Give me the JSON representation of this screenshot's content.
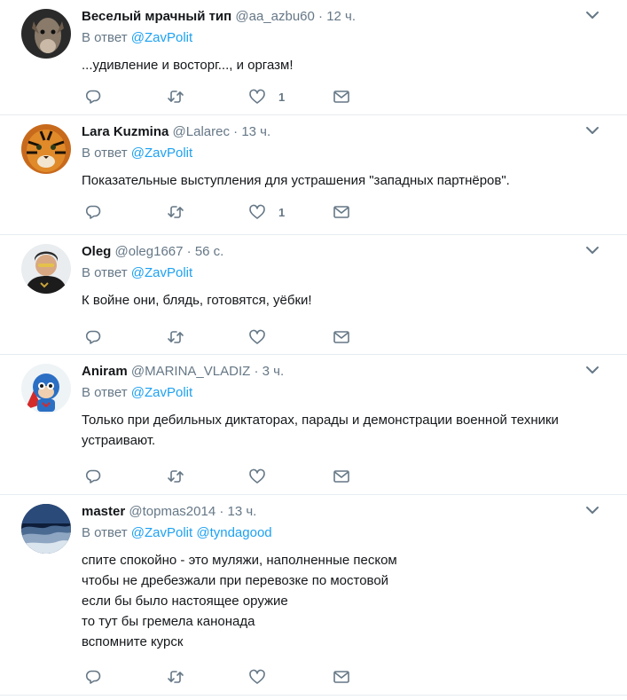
{
  "icons": {
    "reply": "reply-icon",
    "retweet": "retweet-icon",
    "like": "heart-icon",
    "dm": "envelope-icon",
    "caret": "chevron-down-icon"
  },
  "colors": {
    "link": "#1da1f2",
    "secondary": "#657786",
    "text": "#14171a",
    "divider": "#e6ecf0"
  },
  "reply_prefix": "В ответ",
  "tweets": [
    {
      "name": "Веселый мрачный тип",
      "handle": "@aa_azbu60",
      "time": "12 ч.",
      "mentions": [
        "@ZavPolit"
      ],
      "lines": [
        "...удивление и восторг..., и оргазм!"
      ],
      "likes": "1"
    },
    {
      "name": "Lara Kuzmina",
      "handle": "@Lalarec",
      "time": "13 ч.",
      "mentions": [
        "@ZavPolit"
      ],
      "lines": [
        "Показательные выступления для устрашения \"западных партнёров\"."
      ],
      "likes": "1"
    },
    {
      "name": "Oleg",
      "handle": "@oleg1667",
      "time": "56 с.",
      "mentions": [
        "@ZavPolit"
      ],
      "lines": [
        "К войне они, блядь, готовятся, уёбки!"
      ],
      "likes": ""
    },
    {
      "name": "Aniram",
      "handle": "@MARINA_VLADIZ",
      "time": "3 ч.",
      "mentions": [
        "@ZavPolit"
      ],
      "lines": [
        "Только при дебильных диктаторах, парады и демонстрации военной техники",
        "устраивают."
      ],
      "likes": ""
    },
    {
      "name": "master",
      "handle": "@topmas2014",
      "time": "13 ч.",
      "mentions": [
        "@ZavPolit",
        "@tyndagood"
      ],
      "lines": [
        "спите спокойно - это муляжи, наполненные песком",
        "чтобы не дребезжали при перевозке по мостовой",
        "если бы было настоящее оружие",
        "то тут бы гремела канонада",
        "вспомните курск"
      ],
      "likes": ""
    }
  ]
}
